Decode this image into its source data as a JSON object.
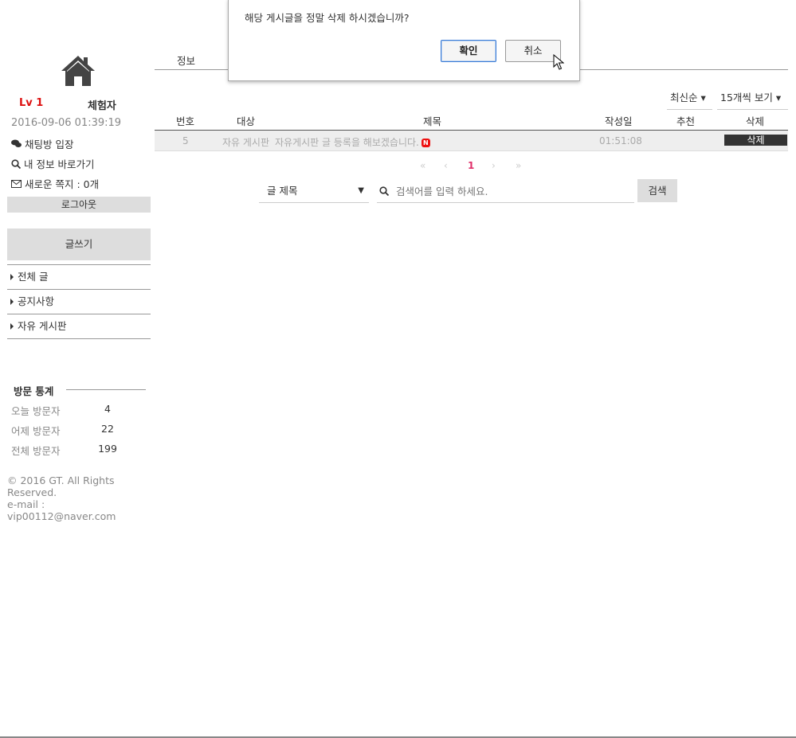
{
  "sidebar": {
    "level": "Lv 1",
    "grade": "체험자",
    "datetime": "2016-09-06 01:39:19",
    "links": [
      "채팅방 입장",
      "내 정보 바로가기",
      "새로운 쪽지 : 0개"
    ],
    "logout": "로그아웃",
    "write": "글쓰기",
    "menu": [
      "전체 글",
      "공지사항",
      "자유 게시판"
    ],
    "stats": {
      "title": "방문 통계",
      "rows": [
        {
          "label": "오늘 방문자",
          "value": "4"
        },
        {
          "label": "어제 방문자",
          "value": "22"
        },
        {
          "label": "전체 방문자",
          "value": "199"
        }
      ]
    },
    "footer": {
      "copyright": "© 2016 GT. All Rights Reserved.",
      "email": "e-mail : vip00112@naver.com"
    }
  },
  "main": {
    "tab": "정보",
    "sort": "최신순 ▾",
    "per_page": "15개씩 보기 ▾",
    "headers": [
      "번호",
      "대상",
      "제목",
      "작성일",
      "추천",
      "삭제"
    ],
    "rows": [
      {
        "num": "5",
        "target": "자유 게시판",
        "title": "자유게시판 글 등록을 해보겠습니다.",
        "badge": "N",
        "date": "01:51:08",
        "recommend": "",
        "delete": "삭제"
      }
    ],
    "pager": {
      "first": "«",
      "prev": "‹",
      "current": "1",
      "next": "›",
      "last": "»"
    },
    "search": {
      "field": "글 제목",
      "placeholder": "검색어를 입력 하세요.",
      "button": "검색"
    }
  },
  "dialog": {
    "message": "해당 게시글을 정말 삭제 하시겠습니까?",
    "ok": "확인",
    "cancel": "취소"
  }
}
